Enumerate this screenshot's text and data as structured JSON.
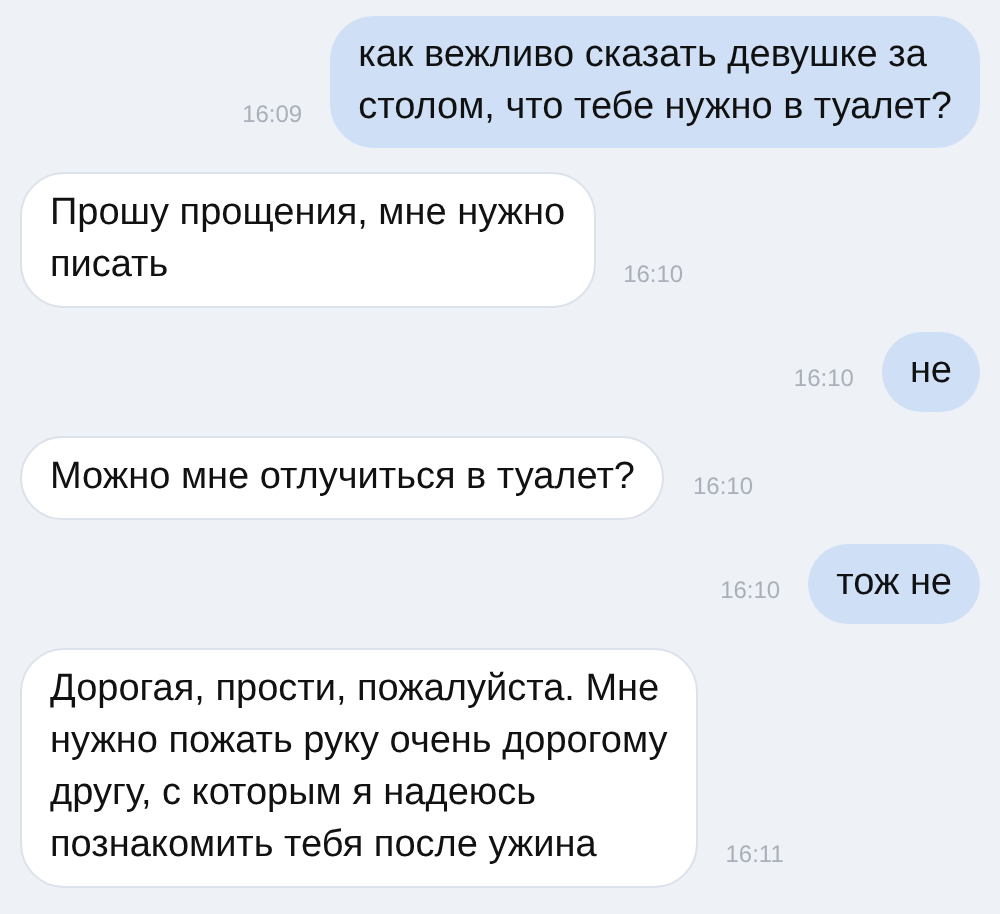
{
  "messages": [
    {
      "kind": "outgoing",
      "text": "как вежливо сказать девушке за\nстолом, что тебе нужно в туалет?",
      "time": "16:09"
    },
    {
      "kind": "incoming",
      "text": "Прошу прощения, мне нужно\nписать",
      "time": "16:10"
    },
    {
      "kind": "outgoing",
      "text": "не",
      "time": "16:10"
    },
    {
      "kind": "incoming",
      "text": "Можно мне отлучиться в туалет?",
      "time": "16:10"
    },
    {
      "kind": "outgoing",
      "text": "тож не",
      "time": "16:10"
    },
    {
      "kind": "incoming",
      "text": "Дорогая, прости, пожалуйста. Мне\nнужно пожать руку очень дорогому\nдругу, с которым я надеюсь\nпознакомить тебя после ужина",
      "time": "16:11"
    }
  ]
}
